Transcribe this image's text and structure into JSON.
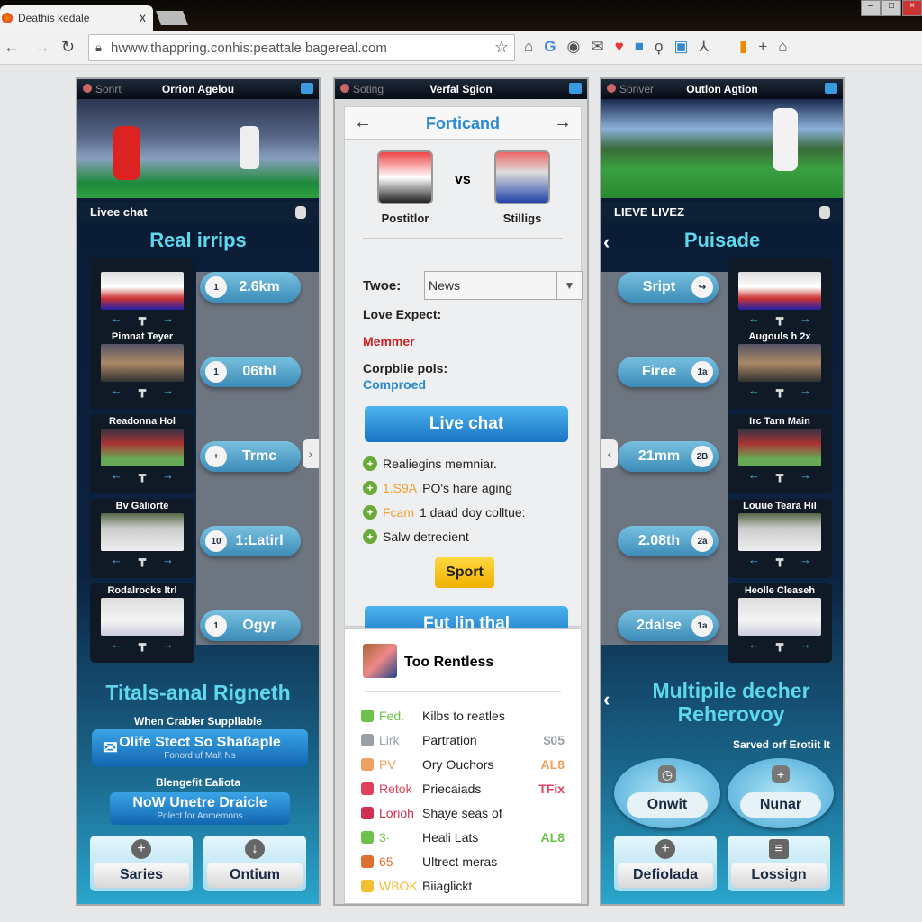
{
  "browser": {
    "tab_title": "Deathis kedale",
    "url": "hwww.thappring.conhis:peattale bagereal.com",
    "close": "x"
  },
  "left": {
    "header_small": "Sonrt",
    "header_title": "Orrion Agelou",
    "subheader": "Livee chat",
    "title": "Real irrips",
    "items": [
      {
        "caption": "",
        "pill": "2.6km",
        "num": "1"
      },
      {
        "caption": "Pimnat Teyer",
        "pill": "06thl",
        "num": "1"
      },
      {
        "caption": "Readonna Hol",
        "pill": "Trmc",
        "num": "+"
      },
      {
        "caption": "Bv Gáliorte",
        "pill": "1:Latirl",
        "num": "10"
      },
      {
        "caption": "Rodalrocks ltrl",
        "pill": "Ogyr",
        "num": "1"
      }
    ],
    "bottom_title": "Titals-anal Rigneth",
    "bottom_sub1": "When Crabler Suppllable",
    "btn1": {
      "label": "Olife Stect So Shaßaple",
      "sub": "Fonord uf Malt Ns"
    },
    "bottom_sub2": "Blengefit Ealiota",
    "btn2": {
      "label": "NoW Unetre Draicle",
      "sub": "Polect for Anmemons"
    },
    "tiles": [
      {
        "label": "Saries",
        "icon": "plus-icon"
      },
      {
        "label": "Ontium",
        "icon": "download-icon"
      }
    ]
  },
  "center": {
    "header_small": "Soting",
    "header_title": "Verfal Sgion",
    "nav_title": "Forticand",
    "player1": "Postitlor",
    "vs": "vs",
    "player2": "Stilligs",
    "type_label": "Twoe:",
    "type_value": "News",
    "expect_label": "Love Expect:",
    "expect_value": "Memmer",
    "pols_label": "Corpblie pols:",
    "pols_value": "Comproed",
    "live_chat": "Live chat",
    "features": [
      {
        "tag": "",
        "text": "Realiegins memniar."
      },
      {
        "tag": "1.S9A",
        "text": "PO's hare aging"
      },
      {
        "tag": "Fcam",
        "text": "1 daad doy colltue:"
      },
      {
        "tag": "",
        "text": "Salw detrecient"
      }
    ],
    "sport_button": "Sport",
    "full_button": "Fut lin thal",
    "list_title": "Too Rentless",
    "list": [
      {
        "key": "Fed.",
        "text": "Kilbs to reatles",
        "value": "",
        "color": "#6cc24a"
      },
      {
        "key": "Lirk",
        "text": "Partration",
        "value": "$05",
        "color": "#9aa0a6"
      },
      {
        "key": "PV",
        "text": "Ory Ouchors",
        "value": "AL8",
        "color": "#f0a060"
      },
      {
        "key": "Retok",
        "text": "Priecaiads",
        "value": "TFix",
        "color": "#e0405a"
      },
      {
        "key": "Lorioh",
        "text": "Shaye seas of",
        "value": "",
        "color": "#d03050"
      },
      {
        "key": "3·",
        "text": "Heali Lats",
        "value": "AL8",
        "color": "#6cc24a"
      },
      {
        "key": "65",
        "text": "Ultrect meras",
        "value": "",
        "color": "#e07030"
      },
      {
        "key": "WBOK",
        "text": "Biiaglickt",
        "value": "",
        "color": "#f0c030"
      }
    ]
  },
  "right": {
    "header_small": "Sonver",
    "header_title": "Outlon Agtion",
    "subheader": "LIEVE LIVEZ",
    "title": "Puisade",
    "items": [
      {
        "caption": "",
        "pill": "Sript",
        "num": "↪"
      },
      {
        "caption": "Augouls h 2x",
        "pill": "Firee",
        "num": "1a"
      },
      {
        "caption": "Irc Tarn Main",
        "pill": "21mm",
        "num": "2B"
      },
      {
        "caption": "Louue Teara Hil",
        "pill": "2.08th",
        "num": "2a"
      },
      {
        "caption": "Heolle Cleaseh",
        "pill": "2dalse",
        "num": "1a"
      }
    ],
    "bottom_title": "Multipile decher Reherovoy",
    "bottom_sub": "Sarved orf Erotiit It",
    "ovals": [
      {
        "label": "Onwit"
      },
      {
        "label": "Nunar"
      }
    ],
    "tiles": [
      {
        "label": "Defiolada",
        "icon": "plus-icon"
      },
      {
        "label": "Lossign",
        "icon": "list-icon"
      }
    ]
  },
  "colors": {
    "accent": "#5fd8ee",
    "button_blue": "#1a74c4",
    "sport_yellow": "#f0b000",
    "red": "#cc2222",
    "link_blue": "#2a88d0"
  }
}
